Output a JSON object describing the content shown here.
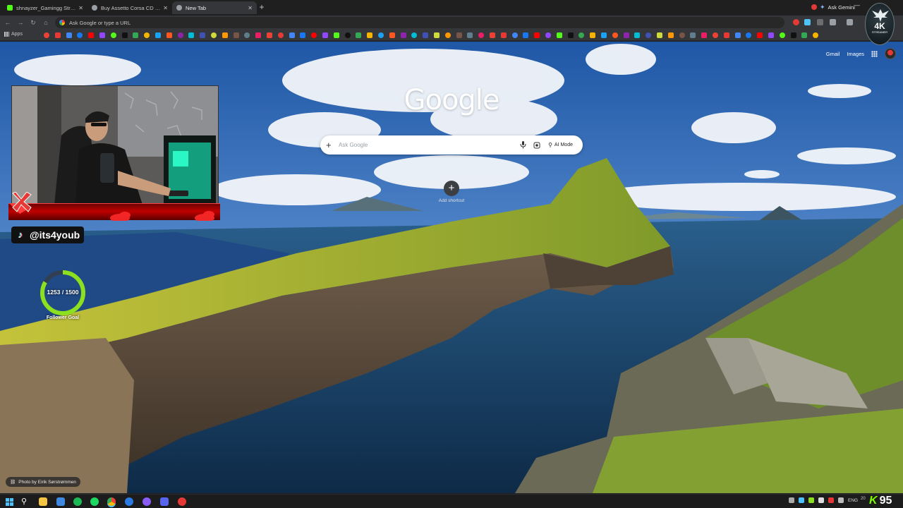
{
  "tabs": [
    {
      "title": "shnayzer_Gamingg Stream - W",
      "favicon_color": "#53fc18",
      "active": false
    },
    {
      "title": "Buy Assetto Corsa CD KEY Com",
      "favicon_color": "#9aa0a6",
      "active": false
    },
    {
      "title": "New Tab",
      "favicon_color": "#9aa0a6",
      "active": true
    }
  ],
  "titlebar": {
    "gemini_label": "Ask Gemini"
  },
  "omnibox": {
    "placeholder": "Ask Google or type a URL"
  },
  "bookmarks": {
    "apps_label": "Apps"
  },
  "newtab": {
    "gmail_label": "Gmail",
    "images_label": "Images",
    "logo_text": "Google",
    "search_placeholder": "Ask Google",
    "ai_mode_label": "AI Mode",
    "add_shortcut_label": "Add shortcut",
    "photo_credit": "Photo by Eirik Sørstrømmen"
  },
  "overlay": {
    "tiktok_handle": "@its4youb",
    "follower_current": 1253,
    "follower_target": 1500,
    "follower_text": "1253 / 1500",
    "follower_label": "Follower Goal",
    "badge_main": "4K",
    "badge_sub": "STREAMER",
    "score_letter": "K",
    "score_value": "95"
  },
  "taskbar": {
    "lang": "ENG",
    "clock": "20"
  },
  "colors": {
    "accent_green": "#7cfc00",
    "overlay_red": "#c00000",
    "ring_green": "#8be11f"
  }
}
